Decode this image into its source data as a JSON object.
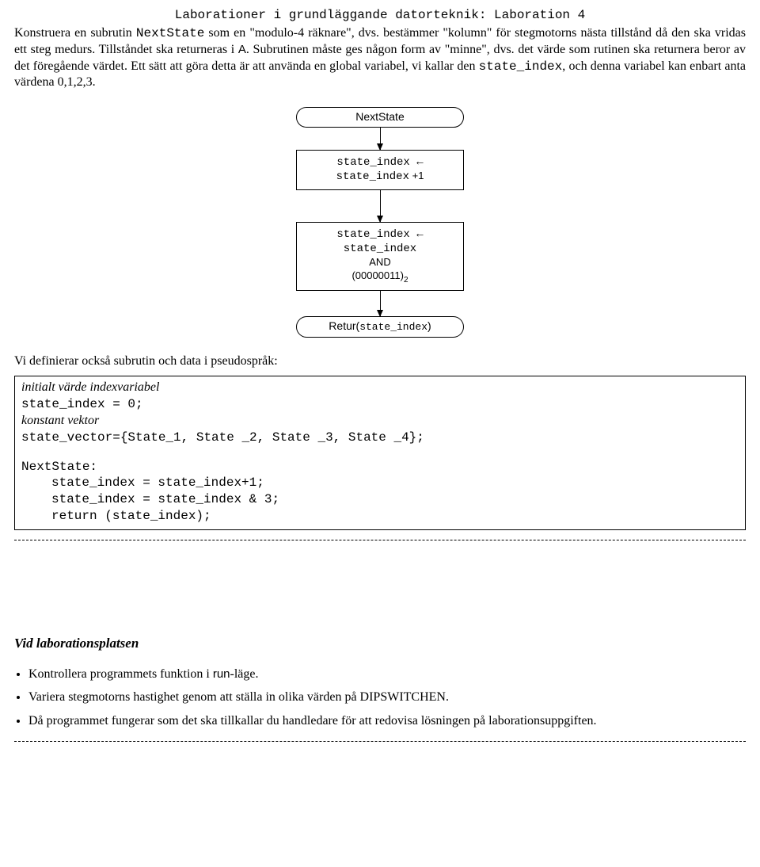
{
  "header": "Laborationer i grundläggande datorteknik: Laboration 4",
  "intro": {
    "p1a": "Konstruera en subrutin ",
    "p1b": "NextState",
    "p1c": " som en \"modulo-4 räknare\", dvs. bestämmer \"kolumn\" för stegmotorns nästa tillstånd då den ska vridas ett steg medurs. Tillståndet ska returneras i ",
    "p1d": "A",
    "p1e": ". Subrutinen måste ges någon form av \"minne\", dvs. det värde som rutinen ska returnera beror av det föregående värdet. Ett sätt att göra detta är att använda en global variabel, vi kallar den ",
    "p1f": "state_index",
    "p1g": ", och denna variabel kan enbart anta värdena 0,1,2,3."
  },
  "flow": {
    "start": "NextState",
    "box1a": "state_index ←",
    "box1b": "state_index",
    "box1c": " +1",
    "box2a": "state_index ←",
    "box2b": "state_index",
    "box2c": "AND",
    "box2d": "(00000011)",
    "box2e": "2",
    "end_a": "Retur(",
    "end_b": "state_index",
    "end_c": ")"
  },
  "midline": "Vi definierar också subrutin och data i pseudospråk:",
  "code": {
    "l1": "initialt värde indexvariabel",
    "l2": "state_index = 0;",
    "l3": "konstant vektor",
    "l4": "state_vector={State_1, State _2, State _3, State _4};",
    "l5": "NextState:",
    "l6": "state_index = state_index+1;",
    "l7": "state_index = state_index & 3;",
    "l8": "return (state_index);"
  },
  "section_heading": "Vid laborationsplatsen",
  "bullets": {
    "b1a": "Kontrollera programmets funktion i ",
    "b1b": "run",
    "b1c": "-läge.",
    "b2": "Variera stegmotorns hastighet genom att ställa  in olika värden på DIPSWITCHEN.",
    "b3": "Då programmet fungerar som det ska tillkallar du handledare för att redovisa lösningen på laborationsuppgiften."
  }
}
